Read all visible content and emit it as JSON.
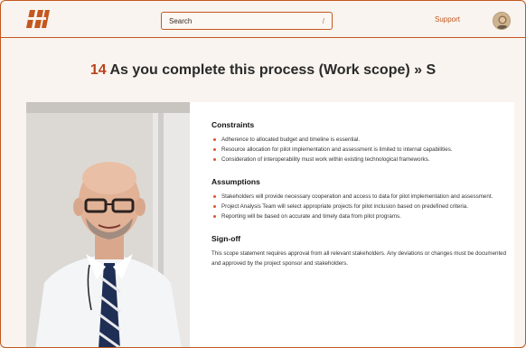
{
  "header": {
    "search": {
      "placeholder": "Search",
      "shortcut": "/"
    },
    "support_label": "Support",
    "colors": {
      "accent": "#c4571f",
      "background": "#f9f4ef"
    }
  },
  "page": {
    "title_number": "14",
    "title_text": "As you complete this process (Work scope) » S"
  },
  "content": {
    "constraints": {
      "heading": "Constraints",
      "items": [
        "Adherence to allocated budget and timeline is essential.",
        "Resource allocation for pilot implementation and assessment is limited to internal capabilities.",
        "Consideration of interoperability must work within existing technological frameworks."
      ]
    },
    "assumptions": {
      "heading": "Assumptions",
      "items": [
        "Stakeholders will provide necessary cooperation and access to data for pilot implementation and assessment.",
        "Project Analysis Team will select appropriate projects for pilot inclusion based on predefined criteria.",
        "Reporting will be based on accurate and timely data from pilot programs."
      ]
    },
    "signoff": {
      "heading": "Sign-off",
      "text": "This scope statement requires approval from all relevant stakeholders. Any deviations or changes must be documented and approved by the project sponsor and stakeholders."
    }
  },
  "icons": {
    "logo": "brand-logo-icon",
    "avatar": "user-avatar"
  }
}
